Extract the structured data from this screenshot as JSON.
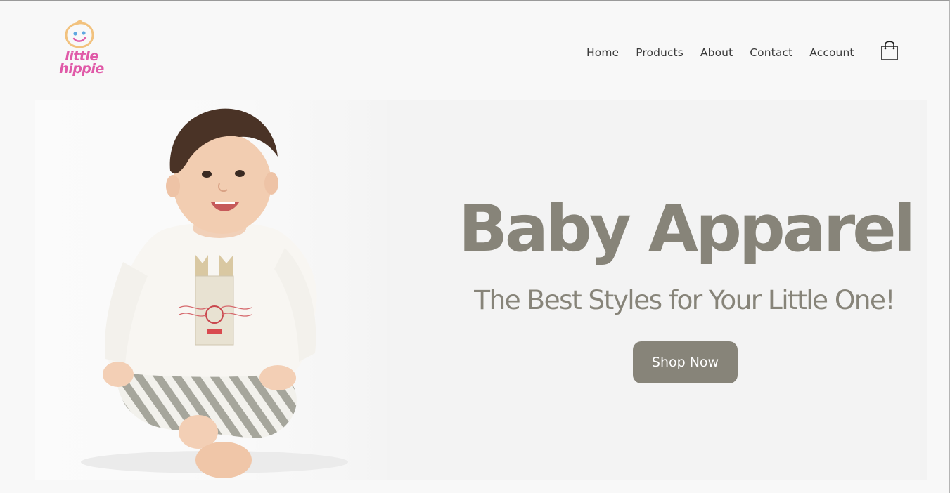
{
  "logo": {
    "line1": "little",
    "line2": "hippie",
    "icon": "baby-face-icon",
    "brand_color": "#e05aa8",
    "face_color": "#f2c27e"
  },
  "nav": {
    "items": [
      {
        "label": "Home"
      },
      {
        "label": "Products"
      },
      {
        "label": "About"
      },
      {
        "label": "Contact"
      },
      {
        "label": "Account"
      }
    ],
    "cart_icon": "shopping-bag-icon"
  },
  "hero": {
    "title": "Baby Apparel",
    "subtitle": "The Best Styles for Your Little One!",
    "cta_label": "Shop Now",
    "image": "baby-photo",
    "accent_color": "#878479"
  }
}
